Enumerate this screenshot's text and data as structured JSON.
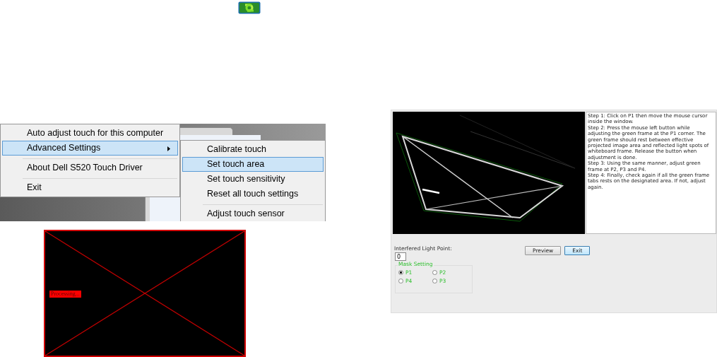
{
  "context_menu": {
    "items": [
      {
        "label": "Auto adjust touch for this computer",
        "selected": false,
        "has_submenu": false,
        "separator_before": false
      },
      {
        "label": "Advanced Settings",
        "selected": true,
        "has_submenu": true,
        "separator_before": false
      },
      {
        "label": "About Dell S520 Touch Driver",
        "selected": false,
        "has_submenu": false,
        "separator_before": true
      },
      {
        "label": "Exit",
        "selected": false,
        "has_submenu": false,
        "separator_before": true
      }
    ]
  },
  "submenu": {
    "items": [
      {
        "label": "Calibrate touch",
        "selected": false,
        "separator_before": false
      },
      {
        "label": "Set touch area",
        "selected": true,
        "separator_before": false
      },
      {
        "label": "Set touch sensitivity",
        "selected": false,
        "separator_before": false
      },
      {
        "label": "Reset all touch settings",
        "selected": false,
        "separator_before": false
      },
      {
        "label": "Adjust touch sensor",
        "selected": false,
        "separator_before": true
      }
    ]
  },
  "processing_window": {
    "status": "Processing..."
  },
  "touch_area_dialog": {
    "instructions": [
      "Step 1: Click on P1 then move the mouse cursor inside the window.",
      "Step 2: Press the mouse left button while adjusting the green frame at the P1 corner. The green frame should rest between effective projected image area and reflected light spots of whiteboard frame. Release the button when adjustment is done.",
      "Step 3: Using the same manner, adjust green frame at P2, P3 and P4.",
      "Step 4: Finally, check again if all the green frame tabs rests on the designated area. If not, adjust again."
    ],
    "interfered_light_point": {
      "label": "Interfered Light Point:",
      "value": "0"
    },
    "mask_setting": {
      "title": "Mask Setting",
      "options": [
        {
          "label": "P1",
          "selected": true
        },
        {
          "label": "P2",
          "selected": false
        },
        {
          "label": "P4",
          "selected": false
        },
        {
          "label": "P3",
          "selected": false
        }
      ]
    },
    "buttons": [
      {
        "label": "Preview",
        "default": false
      },
      {
        "label": "Exit",
        "default": true
      }
    ]
  }
}
